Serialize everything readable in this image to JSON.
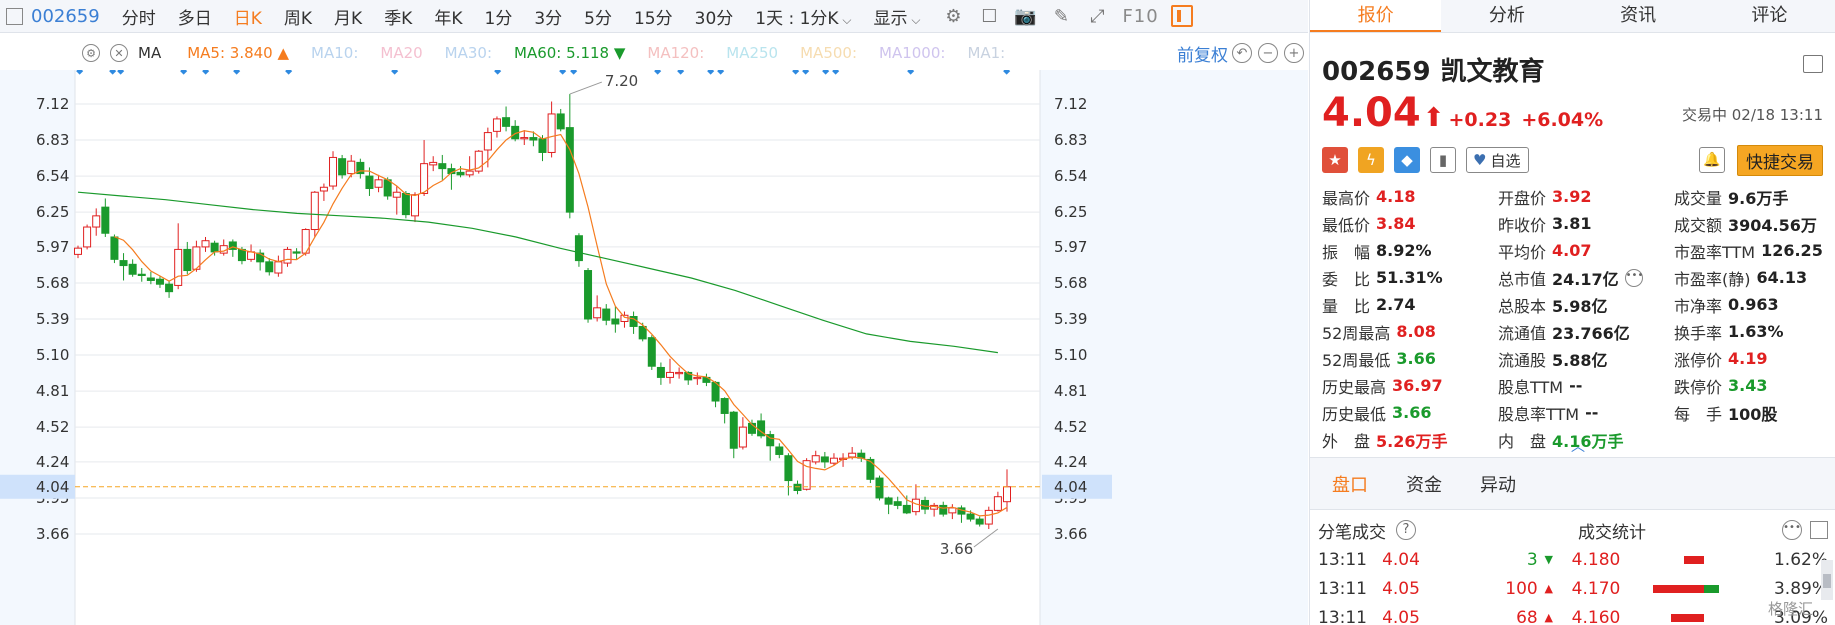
{
  "toolbar": {
    "code": "002659",
    "periods": [
      "分时",
      "多日",
      "日K",
      "周K",
      "月K",
      "季K",
      "年K",
      "1分",
      "3分",
      "5分",
      "15分",
      "30分"
    ],
    "active_period": "日K",
    "custom_period": "1天 : 1分K",
    "display_label": "显示",
    "f10_label": "F10",
    "icons": [
      "settings-icon",
      "square-icon",
      "camera-icon",
      "pen-icon",
      "expand-icon",
      "panel-icon"
    ]
  },
  "ma_bar": {
    "label": "MA",
    "items": [
      {
        "text": "MA5: 3.840 ▲",
        "color": "#f57c1f"
      },
      {
        "text": "MA10:",
        "color": "#b9d3ee"
      },
      {
        "text": "MA20",
        "color": "#f4c0d0"
      },
      {
        "text": "MA30:",
        "color": "#b9d3ee"
      },
      {
        "text": "MA60: 5.118 ▼",
        "color": "#1a9a2c"
      },
      {
        "text": "MA120:",
        "color": "#f4c0c0"
      },
      {
        "text": "MA250",
        "color": "#b9e4ee"
      },
      {
        "text": "MA500:",
        "color": "#f6dcb0"
      },
      {
        "text": "MA1000:",
        "color": "#cfc4ee"
      },
      {
        "text": "MA1:",
        "color": "#c8d2e0"
      }
    ],
    "adjust_label": "前复权"
  },
  "chart_data": {
    "type": "candlestick",
    "y_ticks": [
      "7.12",
      "6.83",
      "6.54",
      "6.25",
      "5.97",
      "5.68",
      "5.39",
      "5.10",
      "4.81",
      "4.52",
      "4.24",
      "3.95",
      "3.66"
    ],
    "ylim": [
      3.55,
      7.3
    ],
    "current_price": "4.04",
    "high_marker": "7.20",
    "low_marker": "3.66",
    "colors": {
      "up": "#e02020",
      "down": "#1a9a2c",
      "ma5": "#f57c1f",
      "ma60": "#1a9a2c",
      "current_line": "#f5a623",
      "grid": "#e6e9ee"
    },
    "candles": [
      [
        5.91,
        5.96,
        5.98,
        5.88
      ],
      [
        5.97,
        6.13,
        6.15,
        5.95
      ],
      [
        6.13,
        6.22,
        6.28,
        6.06
      ],
      [
        6.29,
        6.08,
        6.36,
        6.05
      ],
      [
        6.05,
        5.87,
        6.07,
        5.84
      ],
      [
        5.86,
        5.82,
        5.92,
        5.7
      ],
      [
        5.83,
        5.75,
        5.87,
        5.73
      ],
      [
        5.75,
        5.74,
        5.8,
        5.69
      ],
      [
        5.72,
        5.7,
        5.77,
        5.67
      ],
      [
        5.71,
        5.67,
        5.74,
        5.64
      ],
      [
        5.67,
        5.61,
        5.7,
        5.56
      ],
      [
        5.66,
        5.95,
        6.16,
        5.63
      ],
      [
        5.95,
        5.78,
        6.01,
        5.75
      ],
      [
        5.79,
        5.97,
        6.02,
        5.77
      ],
      [
        5.97,
        6.02,
        6.05,
        5.93
      ],
      [
        6.0,
        5.93,
        6.02,
        5.9
      ],
      [
        5.92,
        5.98,
        6.03,
        5.9
      ],
      [
        6.01,
        5.95,
        6.03,
        5.89
      ],
      [
        5.95,
        5.86,
        5.97,
        5.83
      ],
      [
        5.87,
        5.93,
        5.99,
        5.85
      ],
      [
        5.92,
        5.85,
        5.95,
        5.78
      ],
      [
        5.85,
        5.77,
        5.88,
        5.74
      ],
      [
        5.76,
        5.85,
        5.9,
        5.73
      ],
      [
        5.84,
        5.95,
        5.97,
        5.81
      ],
      [
        5.93,
        5.92,
        5.96,
        5.87
      ],
      [
        5.92,
        6.11,
        6.12,
        5.9
      ],
      [
        6.11,
        6.41,
        6.42,
        6.05
      ],
      [
        6.42,
        6.45,
        6.48,
        6.34
      ],
      [
        6.46,
        6.69,
        6.74,
        6.43
      ],
      [
        6.68,
        6.55,
        6.71,
        6.52
      ],
      [
        6.56,
        6.66,
        6.71,
        6.53
      ],
      [
        6.65,
        6.56,
        6.68,
        6.52
      ],
      [
        6.54,
        6.44,
        6.61,
        6.38
      ],
      [
        6.45,
        6.51,
        6.55,
        6.41
      ],
      [
        6.51,
        6.38,
        6.53,
        6.35
      ],
      [
        6.37,
        6.41,
        6.46,
        6.23
      ],
      [
        6.4,
        6.23,
        6.42,
        6.2
      ],
      [
        6.22,
        6.39,
        6.41,
        6.17
      ],
      [
        6.4,
        6.64,
        6.83,
        6.38
      ],
      [
        6.63,
        6.65,
        6.7,
        6.58
      ],
      [
        6.64,
        6.6,
        6.71,
        6.51
      ],
      [
        6.6,
        6.56,
        6.64,
        6.43
      ],
      [
        6.57,
        6.55,
        6.62,
        6.53
      ],
      [
        6.55,
        6.58,
        6.7,
        6.53
      ],
      [
        6.58,
        6.74,
        6.75,
        6.56
      ],
      [
        6.75,
        6.89,
        6.93,
        6.61
      ],
      [
        6.9,
        7.0,
        7.02,
        6.85
      ],
      [
        7.01,
        6.94,
        7.1,
        6.9
      ],
      [
        6.94,
        6.84,
        6.99,
        6.82
      ],
      [
        6.84,
        6.85,
        6.91,
        6.79
      ],
      [
        6.85,
        6.83,
        6.9,
        6.78
      ],
      [
        6.84,
        6.73,
        6.87,
        6.66
      ],
      [
        6.73,
        7.04,
        7.14,
        6.69
      ],
      [
        7.04,
        6.92,
        7.08,
        6.9
      ],
      [
        6.93,
        6.25,
        7.2,
        6.2
      ],
      [
        6.06,
        5.86,
        6.08,
        5.81
      ],
      [
        5.78,
        5.39,
        5.8,
        5.36
      ],
      [
        5.4,
        5.48,
        5.58,
        5.37
      ],
      [
        5.47,
        5.38,
        5.51,
        5.34
      ],
      [
        5.39,
        5.35,
        5.49,
        5.28
      ],
      [
        5.37,
        5.42,
        5.45,
        5.32
      ],
      [
        5.41,
        5.33,
        5.45,
        5.27
      ],
      [
        5.33,
        5.23,
        5.36,
        5.21
      ],
      [
        5.24,
        5.01,
        5.26,
        4.98
      ],
      [
        5.0,
        4.92,
        5.04,
        4.86
      ],
      [
        4.92,
        4.96,
        5.07,
        4.87
      ],
      [
        4.95,
        4.96,
        5.0,
        4.91
      ],
      [
        4.96,
        4.9,
        4.97,
        4.86
      ],
      [
        4.91,
        4.92,
        4.96,
        4.86
      ],
      [
        4.92,
        4.88,
        4.95,
        4.85
      ],
      [
        4.88,
        4.73,
        4.89,
        4.68
      ],
      [
        4.75,
        4.63,
        4.76,
        4.55
      ],
      [
        4.64,
        4.35,
        4.65,
        4.27
      ],
      [
        4.36,
        4.52,
        4.6,
        4.34
      ],
      [
        4.55,
        4.47,
        4.58,
        4.45
      ],
      [
        4.57,
        4.45,
        4.63,
        4.43
      ],
      [
        4.46,
        4.37,
        4.49,
        4.25
      ],
      [
        4.36,
        4.3,
        4.39,
        4.27
      ],
      [
        4.29,
        4.09,
        4.31,
        3.97
      ],
      [
        4.06,
        4.01,
        4.09,
        3.98
      ],
      [
        4.02,
        4.25,
        4.27,
        4.01
      ],
      [
        4.24,
        4.29,
        4.33,
        4.22
      ],
      [
        4.28,
        4.24,
        4.32,
        4.19
      ],
      [
        4.23,
        4.27,
        4.31,
        4.21
      ],
      [
        4.26,
        4.27,
        4.31,
        4.2
      ],
      [
        4.28,
        4.31,
        4.36,
        4.26
      ],
      [
        4.31,
        4.27,
        4.34,
        4.24
      ],
      [
        4.26,
        4.1,
        4.28,
        4.07
      ],
      [
        4.11,
        3.95,
        4.13,
        3.93
      ],
      [
        3.95,
        3.9,
        3.96,
        3.82
      ],
      [
        3.92,
        3.89,
        3.96,
        3.86
      ],
      [
        3.89,
        3.83,
        3.97,
        3.82
      ],
      [
        3.84,
        3.94,
        4.06,
        3.81
      ],
      [
        3.93,
        3.86,
        3.96,
        3.82
      ],
      [
        3.86,
        3.89,
        3.91,
        3.8
      ],
      [
        3.89,
        3.82,
        3.92,
        3.8
      ],
      [
        3.83,
        3.87,
        3.9,
        3.78
      ],
      [
        3.87,
        3.82,
        3.89,
        3.75
      ],
      [
        3.82,
        3.78,
        3.85,
        3.76
      ],
      [
        3.78,
        3.74,
        3.8,
        3.72
      ],
      [
        3.74,
        3.85,
        3.88,
        3.7
      ],
      [
        3.85,
        3.96,
        4.0,
        3.84
      ],
      [
        3.92,
        4.04,
        4.18,
        3.84
      ]
    ],
    "ma60": [
      6.41,
      6.38,
      6.35,
      6.31,
      6.27,
      6.24,
      6.22,
      6.2,
      6.17,
      6.12,
      6.05,
      5.96,
      5.88,
      5.8,
      5.72,
      5.62,
      5.5,
      5.38,
      5.27,
      5.21,
      5.17,
      5.12
    ],
    "ma60_window": [
      0,
      101
    ]
  },
  "quote": {
    "code": "002659",
    "name": "凯文教育",
    "price": "4.04",
    "arrow": "⬆",
    "change": "+0.23",
    "change_pct": "+6.04%",
    "status": "交易中 02/18 13:11",
    "fav_label": "自选",
    "trade_label": "快捷交易",
    "stats": [
      [
        {
          "l": "最高价",
          "v": "4.18",
          "c": "red"
        },
        {
          "l": "开盘价",
          "v": "3.92",
          "c": "red"
        },
        {
          "l": "成交量",
          "v": "9.6万手",
          "c": ""
        }
      ],
      [
        {
          "l": "最低价",
          "v": "3.84",
          "c": "red"
        },
        {
          "l": "昨收价",
          "v": "3.81",
          "c": ""
        },
        {
          "l": "成交额",
          "v": "3904.56万",
          "c": ""
        }
      ],
      [
        {
          "l": "振　幅",
          "v": "8.92%",
          "c": ""
        },
        {
          "l": "平均价",
          "v": "4.07",
          "c": "red"
        },
        {
          "l": "市盈率TTM",
          "v": "126.25",
          "c": ""
        }
      ],
      [
        {
          "l": "委　比",
          "v": "51.31%",
          "c": ""
        },
        {
          "l": "总市值",
          "v": "24.17亿",
          "c": "",
          "dots": true
        },
        {
          "l": "市盈率(静)",
          "v": "64.13",
          "c": ""
        }
      ],
      [
        {
          "l": "量　比",
          "v": "2.74",
          "c": ""
        },
        {
          "l": "总股本",
          "v": "5.98亿",
          "c": ""
        },
        {
          "l": "市净率",
          "v": "0.963",
          "c": ""
        }
      ],
      [
        {
          "l": "52周最高",
          "v": "8.08",
          "c": "red"
        },
        {
          "l": "流通值",
          "v": "23.766亿",
          "c": ""
        },
        {
          "l": "换手率",
          "v": "1.63%",
          "c": ""
        }
      ],
      [
        {
          "l": "52周最低",
          "v": "3.66",
          "c": "green"
        },
        {
          "l": "流通股",
          "v": "5.88亿",
          "c": ""
        },
        {
          "l": "涨停价",
          "v": "4.19",
          "c": "red"
        }
      ],
      [
        {
          "l": "历史最高",
          "v": "36.97",
          "c": "red"
        },
        {
          "l": "股息TTM",
          "v": "--",
          "c": ""
        },
        {
          "l": "跌停价",
          "v": "3.43",
          "c": "green"
        }
      ],
      [
        {
          "l": "历史最低",
          "v": "3.66",
          "c": "green"
        },
        {
          "l": "股息率TTM",
          "v": "--",
          "c": ""
        },
        {
          "l": "每　手",
          "v": "100股",
          "c": ""
        }
      ],
      [
        {
          "l": "外　盘",
          "v": "5.26万手",
          "c": "red"
        },
        {
          "l": "内　盘",
          "v": "4.16万手",
          "c": "green"
        },
        null
      ]
    ]
  },
  "side_tabs": [
    "报价",
    "分析",
    "资讯",
    "评论"
  ],
  "sub_tabs": [
    "盘口",
    "资金",
    "异动"
  ],
  "ticks": {
    "header_left": "分笔成交",
    "header_right": "成交统计",
    "rows": [
      {
        "time": "13:11",
        "price": "4.04",
        "vol": "3",
        "dir": "dn",
        "stat_price": "4.180",
        "pct": "1.62%",
        "red_w": 0.18,
        "green_w": 0
      },
      {
        "time": "13:11",
        "price": "4.05",
        "vol": "100",
        "dir": "up",
        "stat_price": "4.170",
        "pct": "3.89%",
        "red_w": 0.46,
        "green_w": 0.12
      },
      {
        "time": "13:11",
        "price": "4.05",
        "vol": "68",
        "dir": "up",
        "stat_price": "4.160",
        "pct": "3.09%",
        "red_w": 0.3,
        "green_w": 0
      }
    ]
  },
  "watermark": "格隆汇"
}
